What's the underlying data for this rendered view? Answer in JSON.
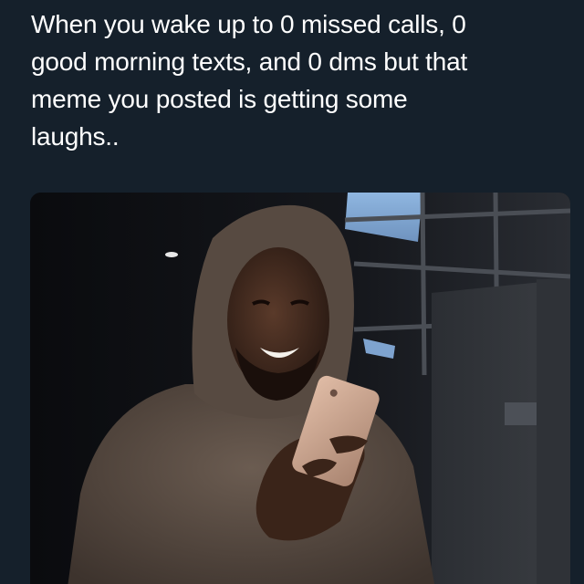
{
  "meme": {
    "caption": "When you wake up to 0 missed calls, 0\ngood morning texts, and 0 dms but that\nmeme you posted is getting some\nlaughs.."
  },
  "colors": {
    "background": "#15202b",
    "caption_text": "#ffffff",
    "hoodie": "#5a4d44",
    "phone": "#c9a48e"
  }
}
